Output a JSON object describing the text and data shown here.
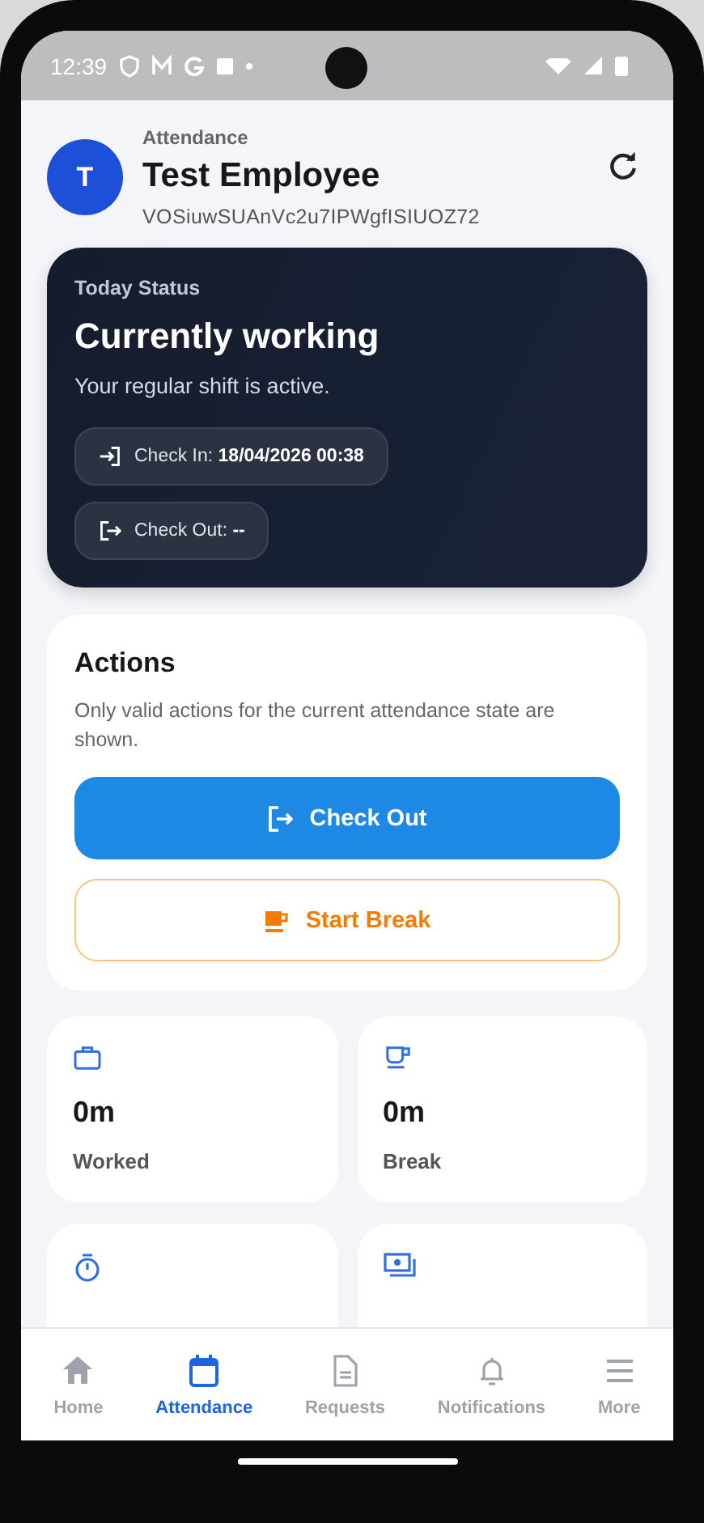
{
  "status_bar": {
    "time": "12:39"
  },
  "header": {
    "overline": "Attendance",
    "avatar_initial": "T",
    "name": "Test Employee",
    "employee_id": "VOSiuwSUAnVc2u7IPWgfISIUOZ72"
  },
  "status_card": {
    "label": "Today Status",
    "title": "Currently working",
    "subtitle": "Your regular shift is active.",
    "chips": [
      {
        "kind": "check_in",
        "label": "Check In:",
        "value": "18/04/2026  00:38"
      },
      {
        "kind": "check_out",
        "label": "Check Out:",
        "value": "--"
      }
    ]
  },
  "actions": {
    "title": "Actions",
    "description": "Only valid actions for the current attendance state are shown.",
    "buttons": [
      {
        "kind": "primary",
        "label": "Check Out"
      },
      {
        "kind": "outline",
        "label": "Start Break"
      }
    ]
  },
  "stats": [
    {
      "value": "0m",
      "label": "Worked"
    },
    {
      "value": "0m",
      "label": "Break"
    }
  ],
  "nav": [
    {
      "label": "Home",
      "selected": false
    },
    {
      "label": "Attendance",
      "selected": true
    },
    {
      "label": "Requests",
      "selected": false
    },
    {
      "label": "Notifications",
      "selected": false
    },
    {
      "label": "More",
      "selected": false
    }
  ]
}
